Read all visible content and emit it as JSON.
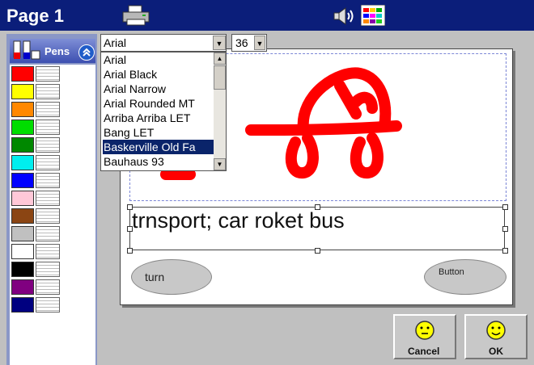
{
  "title": "Page 1",
  "toolbar": {
    "print_icon": "printer-icon",
    "sound_icon": "speaker-icon",
    "palette_icon": "color-palette-icon"
  },
  "pens": {
    "label": "Pens",
    "colors": [
      "#ff0000",
      "#ffff00",
      "#ff8800",
      "#00dd00",
      "#008800",
      "#00eeee",
      "#0000ff",
      "#ffc8d8",
      "#8b4513",
      "#c0c0c0",
      "#ffffff",
      "#000000",
      "#800080",
      "#000080"
    ]
  },
  "font": {
    "selected": "Arial",
    "size": "36",
    "options": [
      "Arial",
      "Arial Black",
      "Arial Narrow",
      "Arial Rounded MT",
      "Arriba Arriba LET",
      "Bang LET",
      "Baskerville Old Fa",
      "Bauhaus 93"
    ],
    "highlighted": "Baskerville Old Fa"
  },
  "page": {
    "text": "trnsport; car roket bus",
    "buttons": {
      "turn": "turn",
      "generic": "Button"
    }
  },
  "actions": {
    "cancel": "Cancel",
    "ok": "OK"
  }
}
